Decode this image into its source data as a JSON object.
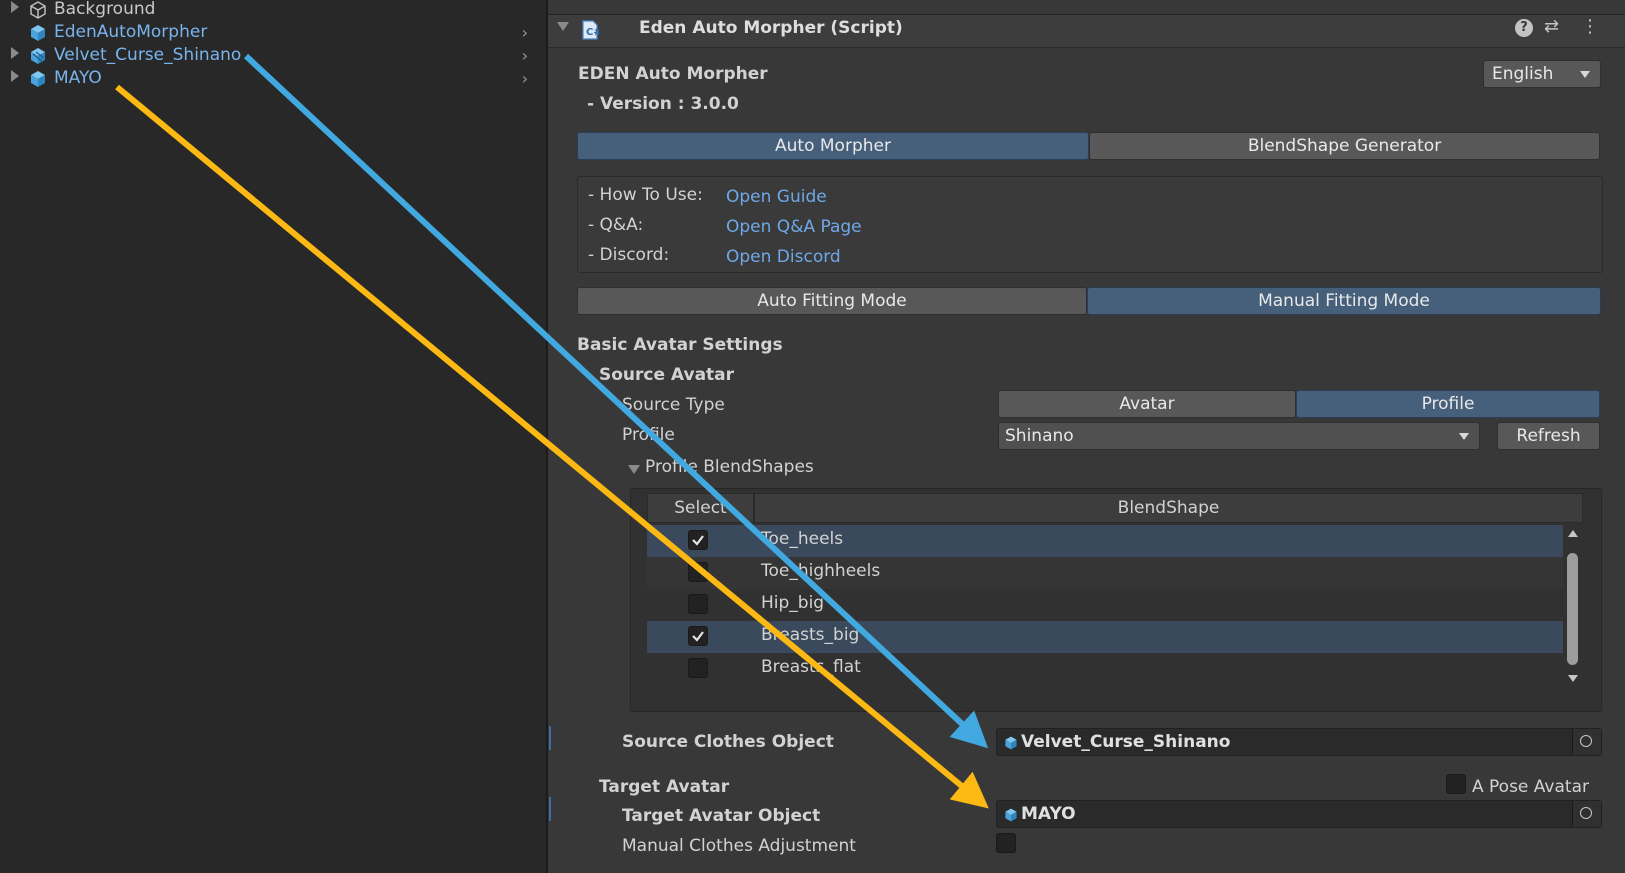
{
  "hierarchy": {
    "items": [
      {
        "label": "Background"
      },
      {
        "label": "EdenAutoMorpher"
      },
      {
        "label": "Velvet_Curse_Shinano"
      },
      {
        "label": "MAYO"
      }
    ]
  },
  "component": {
    "title": "Eden Auto Morpher (Script)",
    "app_name": "EDEN Auto Morpher",
    "version": "- Version : 3.0.0",
    "language": "English"
  },
  "main_tabs": [
    "Auto Morpher",
    "BlendShape Generator"
  ],
  "links": [
    {
      "label": "- How To Use:",
      "link": "Open Guide"
    },
    {
      "label": "- Q&A:",
      "link": "Open Q&A Page"
    },
    {
      "label": "- Discord:",
      "link": "Open Discord"
    }
  ],
  "mode_tabs": [
    "Auto Fitting Mode",
    "Manual Fitting Mode"
  ],
  "settings": {
    "section_title": "Basic Avatar Settings",
    "source_avatar": "Source Avatar",
    "source_type_label": "Source Type",
    "source_type_options": [
      "Avatar",
      "Profile"
    ],
    "profile_label": "Profile",
    "profile_value": "Shinano",
    "refresh": "Refresh",
    "profile_blendshapes": "Profile BlendShapes",
    "table_headers": [
      "Select",
      "BlendShape"
    ],
    "blendshapes": [
      {
        "name": "Toe_heels",
        "checked": true
      },
      {
        "name": "Toe_highheels",
        "checked": false
      },
      {
        "name": "Hip_big",
        "checked": false
      },
      {
        "name": "Breasts_big",
        "checked": true
      },
      {
        "name": "Breasts_flat",
        "checked": false
      }
    ],
    "source_clothes_label": "Source Clothes Object",
    "source_clothes_value": "Velvet_Curse_Shinano",
    "target_avatar": "Target Avatar",
    "a_pose_label": "A Pose Avatar",
    "target_object_label": "Target Avatar Object",
    "target_object_value": "MAYO",
    "manual_adjust_label": "Manual Clothes Adjustment"
  },
  "colors": {
    "arrow_blue": "#41a9df",
    "arrow_yellow": "#fcb813",
    "link": "#6fa8e8",
    "active_tab": "#46607c"
  }
}
